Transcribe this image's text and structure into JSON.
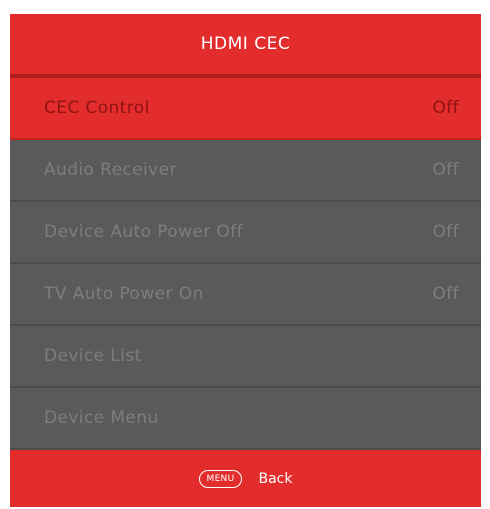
{
  "menu": {
    "title": "HDMI CEC",
    "items": [
      {
        "label": "CEC Control",
        "value": "Off",
        "selected": true
      },
      {
        "label": "Audio Receiver",
        "value": "Off"
      },
      {
        "label": "Device Auto Power Off",
        "value": "Off"
      },
      {
        "label": "TV Auto Power On",
        "value": "Off"
      },
      {
        "label": "Device List",
        "value": ""
      },
      {
        "label": "Device Menu",
        "value": ""
      }
    ]
  },
  "footer": {
    "button_label": "MENU",
    "action_label": "Back"
  },
  "colors": {
    "accent_red": "#e32c2c",
    "panel_gray": "#5a5a5a",
    "disabled_text": "#7d7d7d",
    "selected_text": "#8e1313"
  }
}
